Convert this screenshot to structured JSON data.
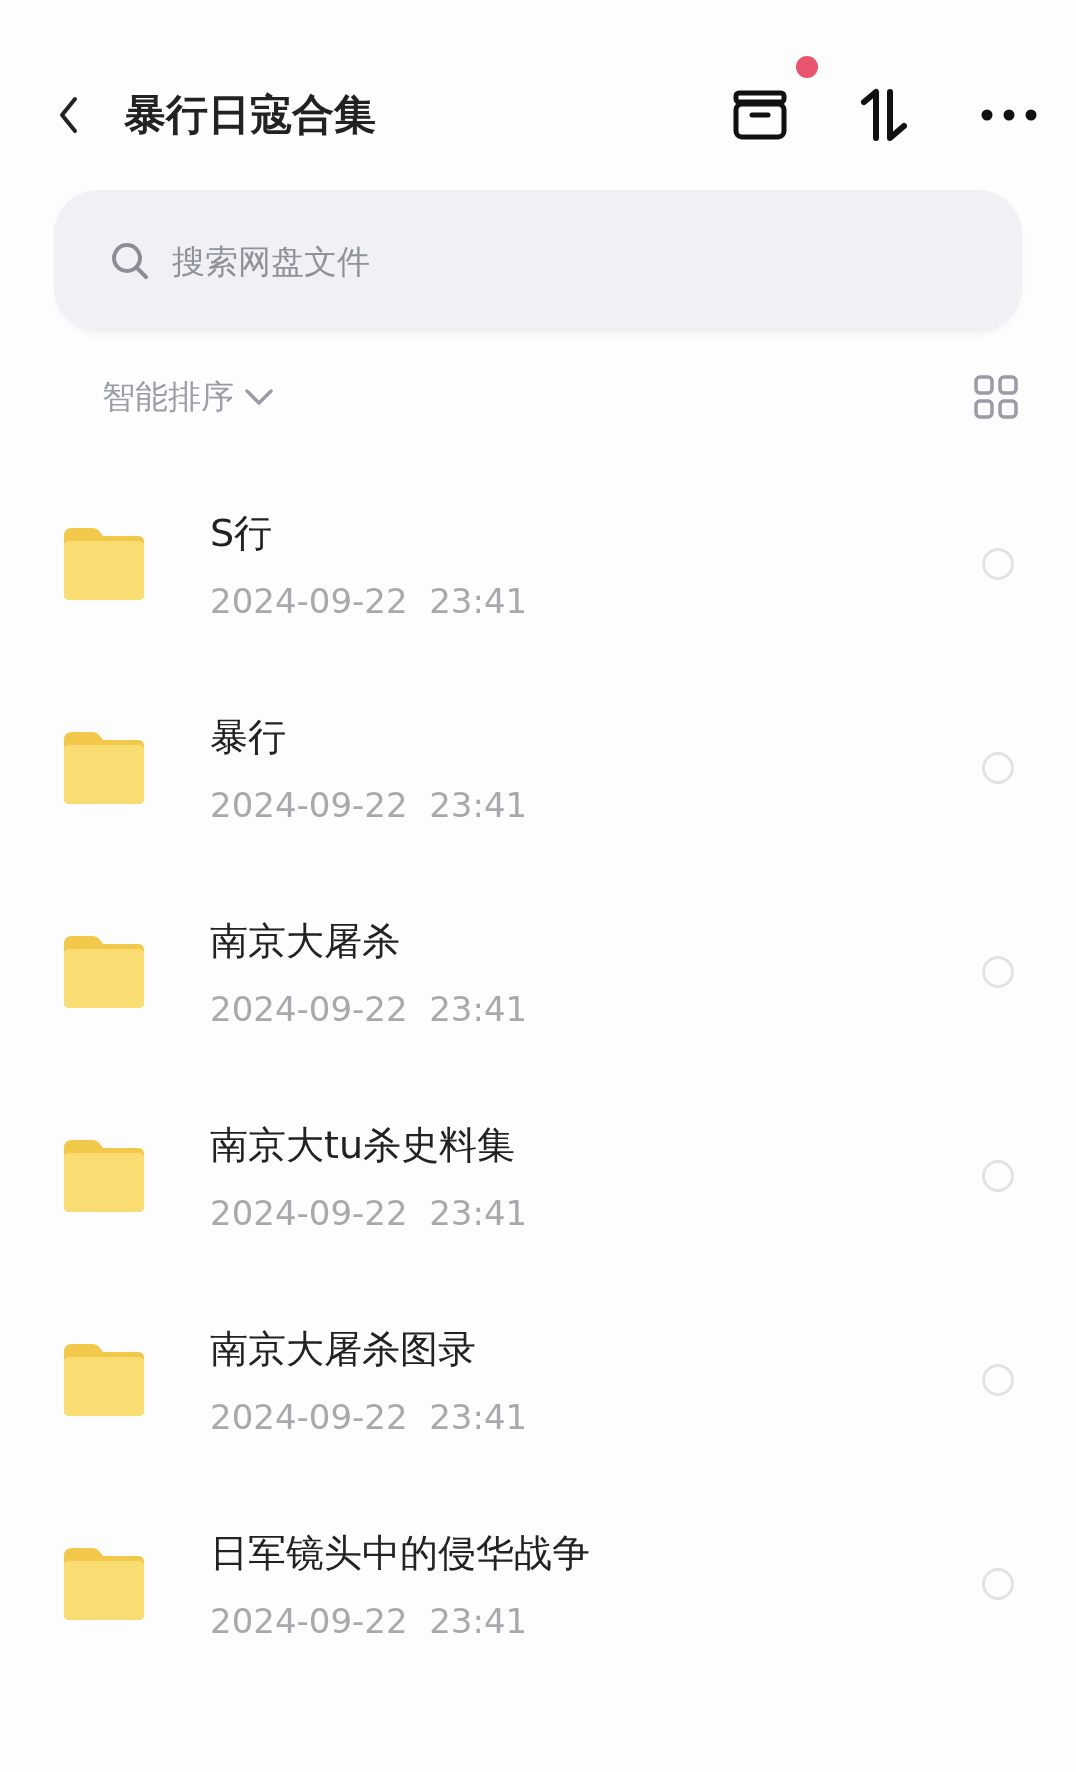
{
  "header": {
    "title": "暴行日寇合集",
    "notification_dot": true
  },
  "search": {
    "placeholder": "搜索网盘文件"
  },
  "sort": {
    "label": "智能排序"
  },
  "files": [
    {
      "name": "S行",
      "date": "2024-09-22  23:41",
      "selected": false
    },
    {
      "name": "暴行",
      "date": "2024-09-22  23:41",
      "selected": false
    },
    {
      "name": "南京大屠杀",
      "date": "2024-09-22  23:41",
      "selected": false
    },
    {
      "name": "南京大tu杀史料集",
      "date": "2024-09-22  23:41",
      "selected": false
    },
    {
      "name": "南京大屠杀图录",
      "date": "2024-09-22  23:41",
      "selected": false
    },
    {
      "name": "日军镜头中的侵华战争",
      "date": "2024-09-22  23:41",
      "selected": false
    }
  ]
}
